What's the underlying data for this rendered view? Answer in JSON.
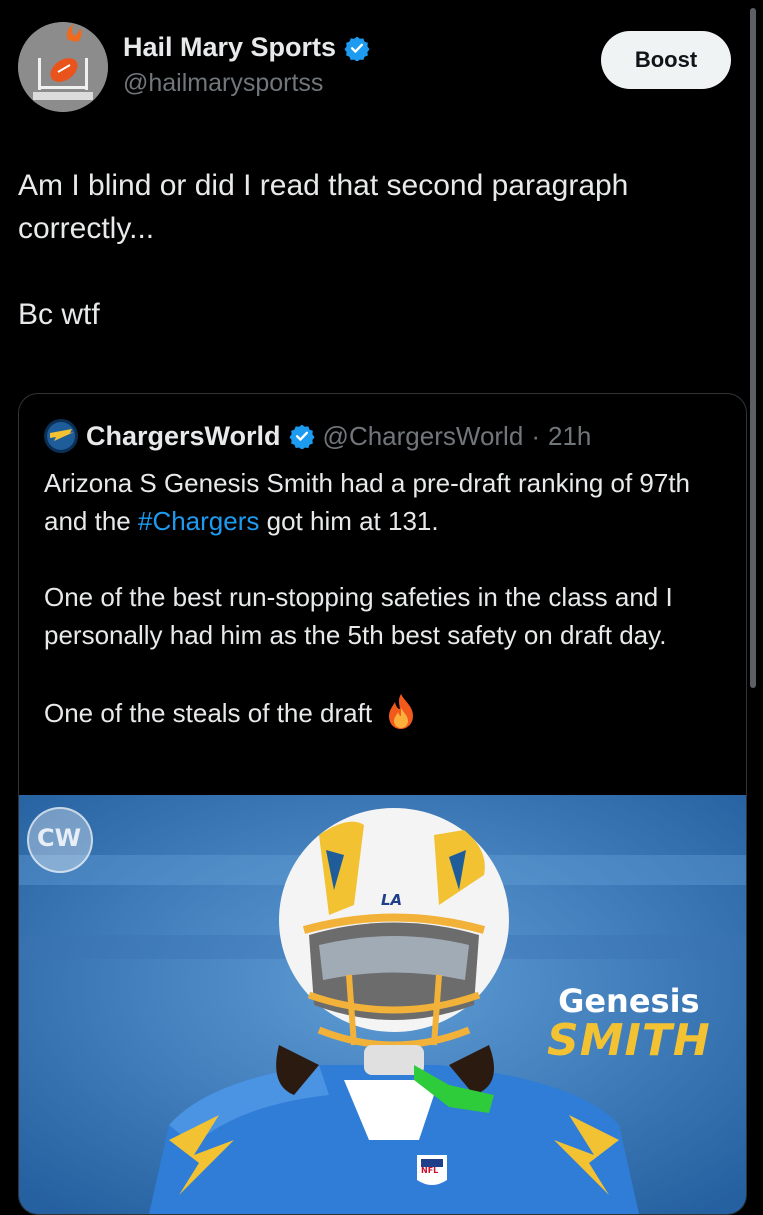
{
  "author": {
    "display_name": "Hail Mary Sports",
    "handle": "@hailmarysportss",
    "avatar_icon": "football-goalpost-icon",
    "verified_color": "#1d9bf0"
  },
  "boost_label": "Boost",
  "tweet": {
    "lines": [
      "Am I blind or did I read that second paragraph correctly...",
      "Bc wtf"
    ]
  },
  "quote": {
    "display_name": "ChargersWorld",
    "handle": "@ChargersWorld",
    "separator": "·",
    "time": "21h",
    "para1_before": "Arizona S Genesis Smith had a pre-draft ranking of 97th and the ",
    "hashtag": "#Chargers",
    "para1_after": " got him at 131.",
    "para2": "One of the best run-stopping safeties in the class and I personally had him as the 5th best safety on draft day.",
    "para3": "One of the steals of the draft",
    "emoji_icon": "fire-icon"
  },
  "media": {
    "logo_text": "CW",
    "helmet_text": "LA",
    "first_name": "Genesis",
    "last_name": "SMITH",
    "nfl_shield_text": "NFL"
  }
}
